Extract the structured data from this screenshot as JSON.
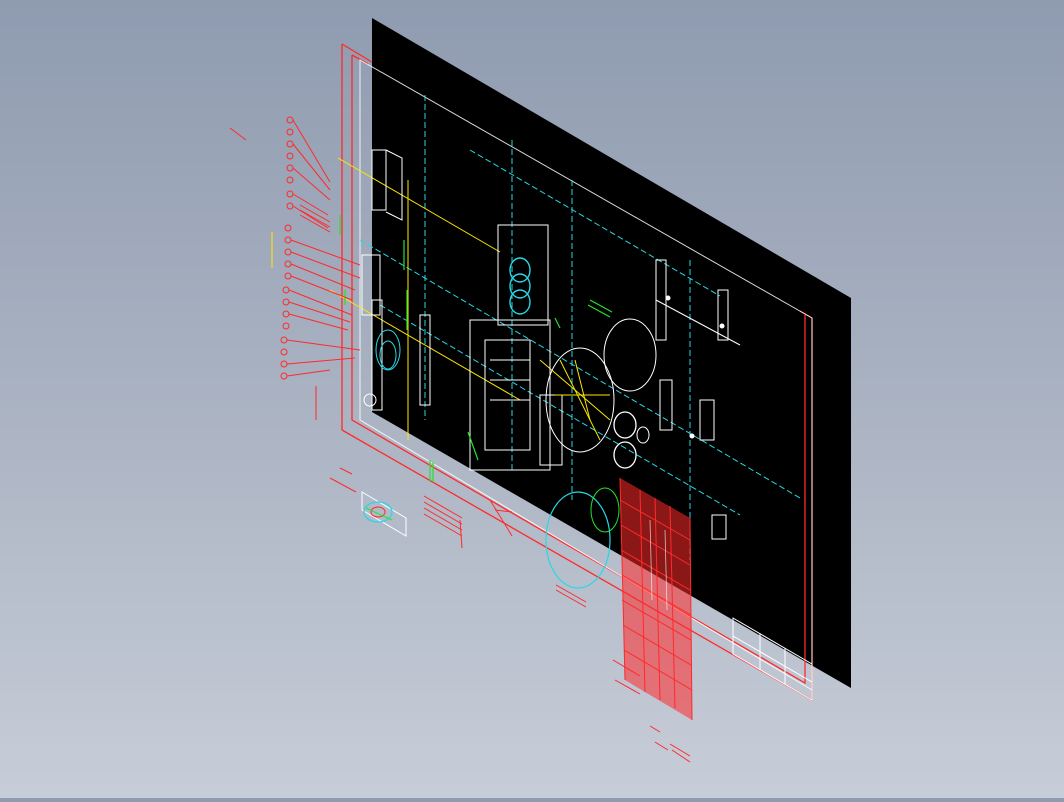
{
  "viewport": {
    "kind": "cad-3d-view",
    "projection": "isometric",
    "background_colors": [
      "#8f9bb0",
      "#c7cdd8"
    ],
    "layer_colors": {
      "sheet": "#000000",
      "border": "#ff2a2a",
      "outline": "#ffffff",
      "centerline": "#27d8e6",
      "dimension": "#ffe600",
      "hatch": "#22e32b",
      "table": "#ff2a2a"
    }
  }
}
